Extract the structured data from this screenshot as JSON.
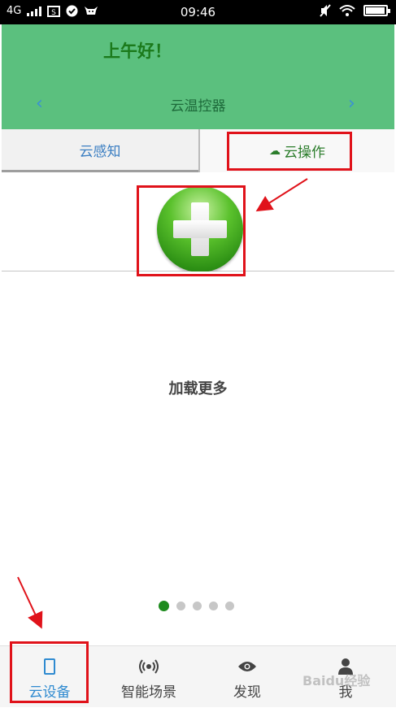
{
  "status_bar": {
    "network": "4G",
    "time": "09:46",
    "battery_level": 0.95
  },
  "header": {
    "greeting": "上午好！",
    "device_title": "云温控器",
    "prev_icon": "chevron-left-icon",
    "next_icon": "chevron-right-icon",
    "background_color": "#5bc07e"
  },
  "tabs": [
    {
      "label": "云感知",
      "selected": false
    },
    {
      "label": "云操作",
      "selected": true,
      "icon": "cloud-icon"
    }
  ],
  "add_button": {
    "icon": "plus-icon"
  },
  "content": {
    "load_more": "加载更多",
    "pager": {
      "count": 5,
      "active_index": 0
    }
  },
  "bottom_nav": [
    {
      "label": "云设备",
      "icon": "phone-icon",
      "selected": true
    },
    {
      "label": "智能场景",
      "icon": "broadcast-icon",
      "selected": false
    },
    {
      "label": "发现",
      "icon": "eye-icon",
      "selected": false
    },
    {
      "label": "我",
      "icon": "person-icon",
      "selected": false
    }
  ],
  "watermark": "Baidu经验",
  "colors": {
    "accent_green": "#1d8b1d",
    "nav_active": "#2e8ad0",
    "annotation_red": "#e0121a"
  }
}
